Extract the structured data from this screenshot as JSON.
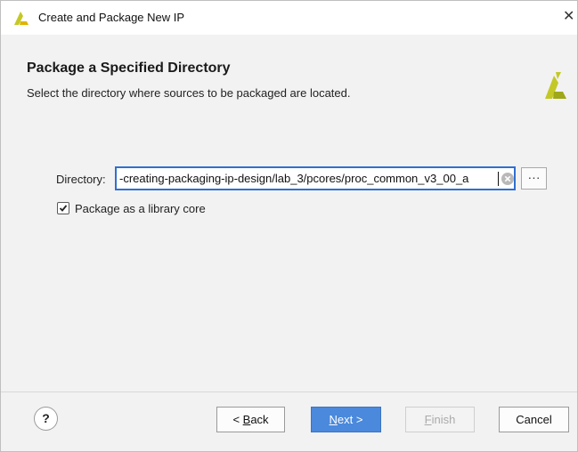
{
  "window": {
    "title": "Create and Package New IP",
    "close_glyph": "✕"
  },
  "header": {
    "heading": "Package a Specified Directory",
    "subheading": "Select the directory where sources to be packaged are located."
  },
  "directory": {
    "label": "Directory:",
    "value": "-creating-packaging-ip-design/lab_3/pcores/proc_common_v3_00_a",
    "browse_label": "···"
  },
  "options": {
    "package_library_core_label": "Package as a library core",
    "package_library_core_checked": true
  },
  "footer": {
    "help_label": "?",
    "back": {
      "mnemonic": "B",
      "rest": "ack",
      "prefix": "< "
    },
    "next": {
      "mnemonic": "N",
      "rest": "ext >"
    },
    "finish": {
      "mnemonic": "F",
      "rest": "inish"
    },
    "cancel_label": "Cancel"
  },
  "colors": {
    "accent": "#2f6fd1",
    "primary_button": "#4a89dc",
    "logo": "#c4c826"
  },
  "icons": {
    "app": "xilinx-logo-icon",
    "header": "xilinx-logo-icon",
    "clear": "clear-circle-icon"
  }
}
